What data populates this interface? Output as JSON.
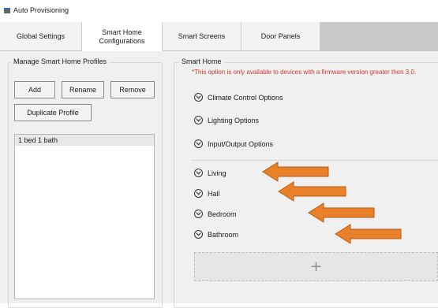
{
  "window": {
    "title": "Auto Provisioning"
  },
  "tabs": [
    {
      "label": "Global Settings",
      "active": false
    },
    {
      "label": "Smart Home\nConfigurations",
      "active": true
    },
    {
      "label": "Smart Screens",
      "active": false
    },
    {
      "label": "Door Panels",
      "active": false
    }
  ],
  "profiles": {
    "group_title": "Manage Smart Home Profiles",
    "add_label": "Add",
    "rename_label": "Rename",
    "remove_label": "Remove",
    "duplicate_label": "Duplicate Profile",
    "items": [
      "1 bed 1 bath"
    ]
  },
  "smart_home": {
    "group_title": "Smart Home",
    "warning": "*This option is only available to devices with a firmware version greater then 3.0.",
    "options": [
      {
        "label": "Climate Control Options"
      },
      {
        "label": "Lighting Options"
      },
      {
        "label": "Input/Output Options"
      }
    ],
    "rooms": [
      {
        "label": "Living"
      },
      {
        "label": "Hall"
      },
      {
        "label": "Bedroom"
      },
      {
        "label": "Bathroom"
      }
    ],
    "add_symbol": "+"
  },
  "colors": {
    "warning": "#d23a2a",
    "arrow_fill": "#e8812a",
    "arrow_stroke": "#b65a12",
    "tabbar": "#c9c9c9"
  }
}
